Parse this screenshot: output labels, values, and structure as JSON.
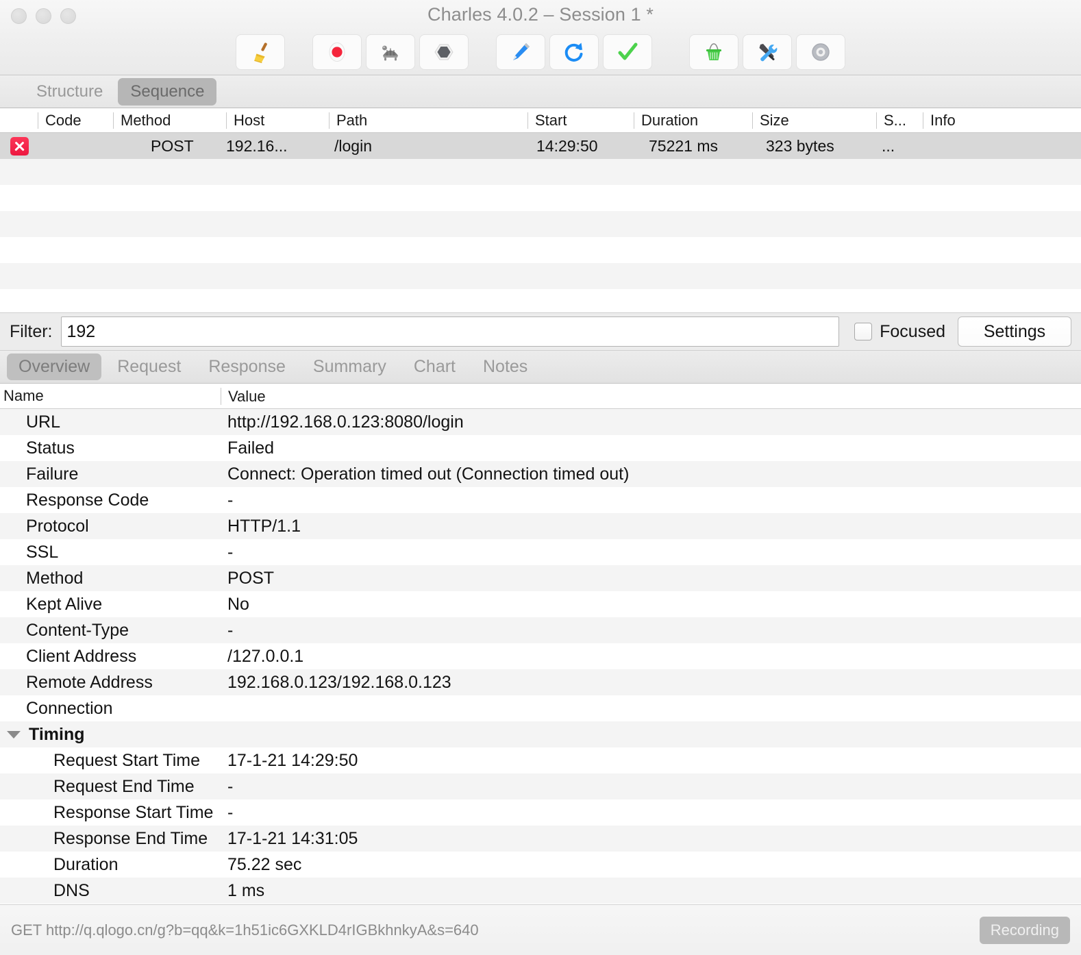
{
  "window": {
    "title": "Charles 4.0.2 – Session 1 *",
    "traffic_lights": [
      "close",
      "minimize",
      "zoom"
    ]
  },
  "toolbar": {
    "buttons": [
      {
        "name": "clear-session-button",
        "icon": "broom-icon",
        "label": "Clear"
      },
      {
        "name": "record-button",
        "icon": "record-icon",
        "label": "Start/Stop Recording"
      },
      {
        "name": "throttle-button",
        "icon": "turtle-icon",
        "label": "Throttling"
      },
      {
        "name": "breakpoints-button",
        "icon": "hexagon-icon",
        "label": "Breakpoints"
      },
      {
        "name": "compose-button",
        "icon": "pen-icon",
        "label": "Compose"
      },
      {
        "name": "repeat-button",
        "icon": "refresh-icon",
        "label": "Repeat"
      },
      {
        "name": "validate-button",
        "icon": "checkmark-icon",
        "label": "Validate"
      },
      {
        "name": "tools-basket-button",
        "icon": "basket-icon",
        "label": "Tools"
      },
      {
        "name": "settings-tools-button",
        "icon": "wrench-screwdriver-icon",
        "label": "Tools"
      },
      {
        "name": "preferences-button",
        "icon": "gear-icon",
        "label": "Preferences"
      }
    ]
  },
  "view_tabs": {
    "items": [
      {
        "label": "Structure",
        "active": false
      },
      {
        "label": "Sequence",
        "active": true
      }
    ]
  },
  "request_list": {
    "columns": [
      "",
      "Code",
      "Method",
      "Host",
      "Path",
      "Start",
      "Duration",
      "Size",
      "S...",
      "Info"
    ],
    "rows": [
      {
        "status_icon": "error-x-icon",
        "code": "",
        "method": "POST",
        "host": "192.16...",
        "path": "/login",
        "start": "14:29:50",
        "duration": "75221 ms",
        "size": "323 bytes",
        "s": "...",
        "info": "",
        "selected": true
      }
    ]
  },
  "filter": {
    "label": "Filter:",
    "value": "192",
    "placeholder": "",
    "focused_label": "Focused",
    "focused_checked": false,
    "settings_label": "Settings"
  },
  "detail_tabs": {
    "items": [
      {
        "label": "Overview",
        "active": true
      },
      {
        "label": "Request",
        "active": false
      },
      {
        "label": "Response",
        "active": false
      },
      {
        "label": "Summary",
        "active": false
      },
      {
        "label": "Chart",
        "active": false
      },
      {
        "label": "Notes",
        "active": false
      }
    ]
  },
  "detail_table": {
    "columns": {
      "name": "Name",
      "value": "Value"
    },
    "rows": [
      {
        "name": "URL",
        "value": "http://192.168.0.123:8080/login",
        "level": 1
      },
      {
        "name": "Status",
        "value": "Failed",
        "level": 1
      },
      {
        "name": "Failure",
        "value": "Connect: Operation timed out (Connection timed out)",
        "level": 1
      },
      {
        "name": "Response Code",
        "value": "-",
        "level": 1
      },
      {
        "name": "Protocol",
        "value": "HTTP/1.1",
        "level": 1
      },
      {
        "name": "SSL",
        "value": "-",
        "level": 1
      },
      {
        "name": "Method",
        "value": "POST",
        "level": 1
      },
      {
        "name": "Kept Alive",
        "value": "No",
        "level": 1
      },
      {
        "name": "Content-Type",
        "value": "-",
        "level": 1
      },
      {
        "name": "Client Address",
        "value": "/127.0.0.1",
        "level": 1
      },
      {
        "name": "Remote Address",
        "value": "192.168.0.123/192.168.0.123",
        "level": 1
      },
      {
        "name": "Connection",
        "value": "",
        "level": 1
      },
      {
        "name": "Timing",
        "value": "",
        "level": 0,
        "group": true,
        "expanded": true
      },
      {
        "name": "Request Start Time",
        "value": "17-1-21 14:29:50",
        "level": 2
      },
      {
        "name": "Request End Time",
        "value": "-",
        "level": 2
      },
      {
        "name": "Response Start Time",
        "value": "-",
        "level": 2
      },
      {
        "name": "Response End Time",
        "value": "17-1-21 14:31:05",
        "level": 2
      },
      {
        "name": "Duration",
        "value": "75.22 sec",
        "level": 2
      },
      {
        "name": "DNS",
        "value": "1 ms",
        "level": 2
      }
    ]
  },
  "status_bar": {
    "text": "GET http://q.qlogo.cn/g?b=qq&k=1h51ic6GXKLD4rIGBkhnkyA&s=640",
    "recording_label": "Recording"
  },
  "colors": {
    "error_red": "#ed1840",
    "accent_blue": "#2a8df2",
    "record_red": "#f5253c",
    "check_green": "#4cd24c",
    "basket_green": "#3ec13e",
    "toolbar_bg": "#efefef",
    "selected_row": "#d8d8d8",
    "stripe": "#f4f4f4"
  }
}
